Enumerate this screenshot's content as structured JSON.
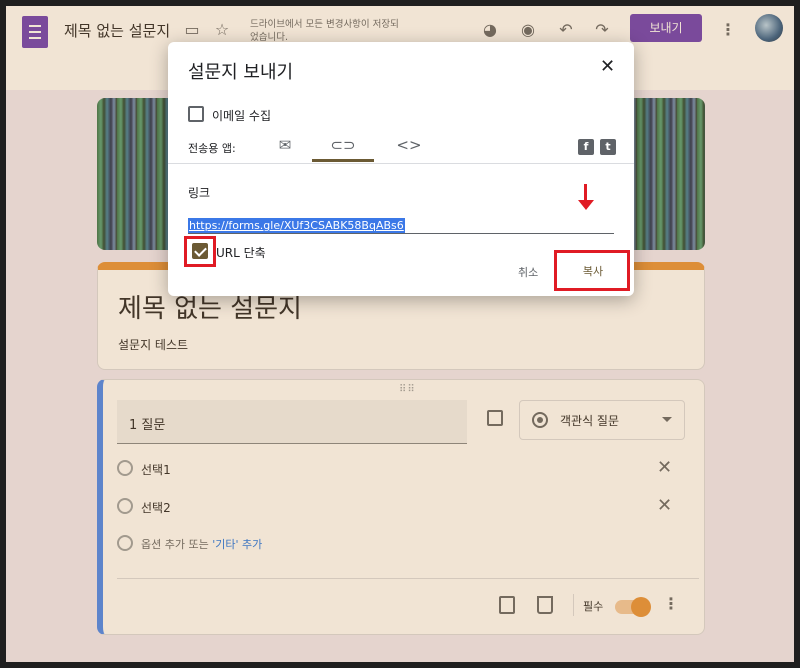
{
  "header": {
    "doc_title": "제목 없는 설문지",
    "save_status": "드라이브에서 모든 변경사항이 저장되었습니다.",
    "send_label": "보내기"
  },
  "form": {
    "title": "제목 없는 설문지",
    "description": "설문지 테스트",
    "question": {
      "title": "1 질문",
      "type": "객관식 질문",
      "options": [
        "선택1",
        "선택2"
      ],
      "add_option_prefix": "옵션 추가",
      "add_option_or": "또는",
      "add_other": "'기타' 추가",
      "required_label": "필수"
    }
  },
  "dialog": {
    "title": "설문지 보내기",
    "collect_email_label": "이메일 수집",
    "send_via_label": "전송용 앱:",
    "link_label": "링크",
    "link_url": "https://forms.gle/XUf3CSABK58BqABs6",
    "shorten_url_label": "URL 단축",
    "cancel_label": "취소",
    "copy_label": "복사"
  },
  "colors": {
    "brand": "#673ab7",
    "accent": "#e69138",
    "annotation": "#e01b24"
  }
}
